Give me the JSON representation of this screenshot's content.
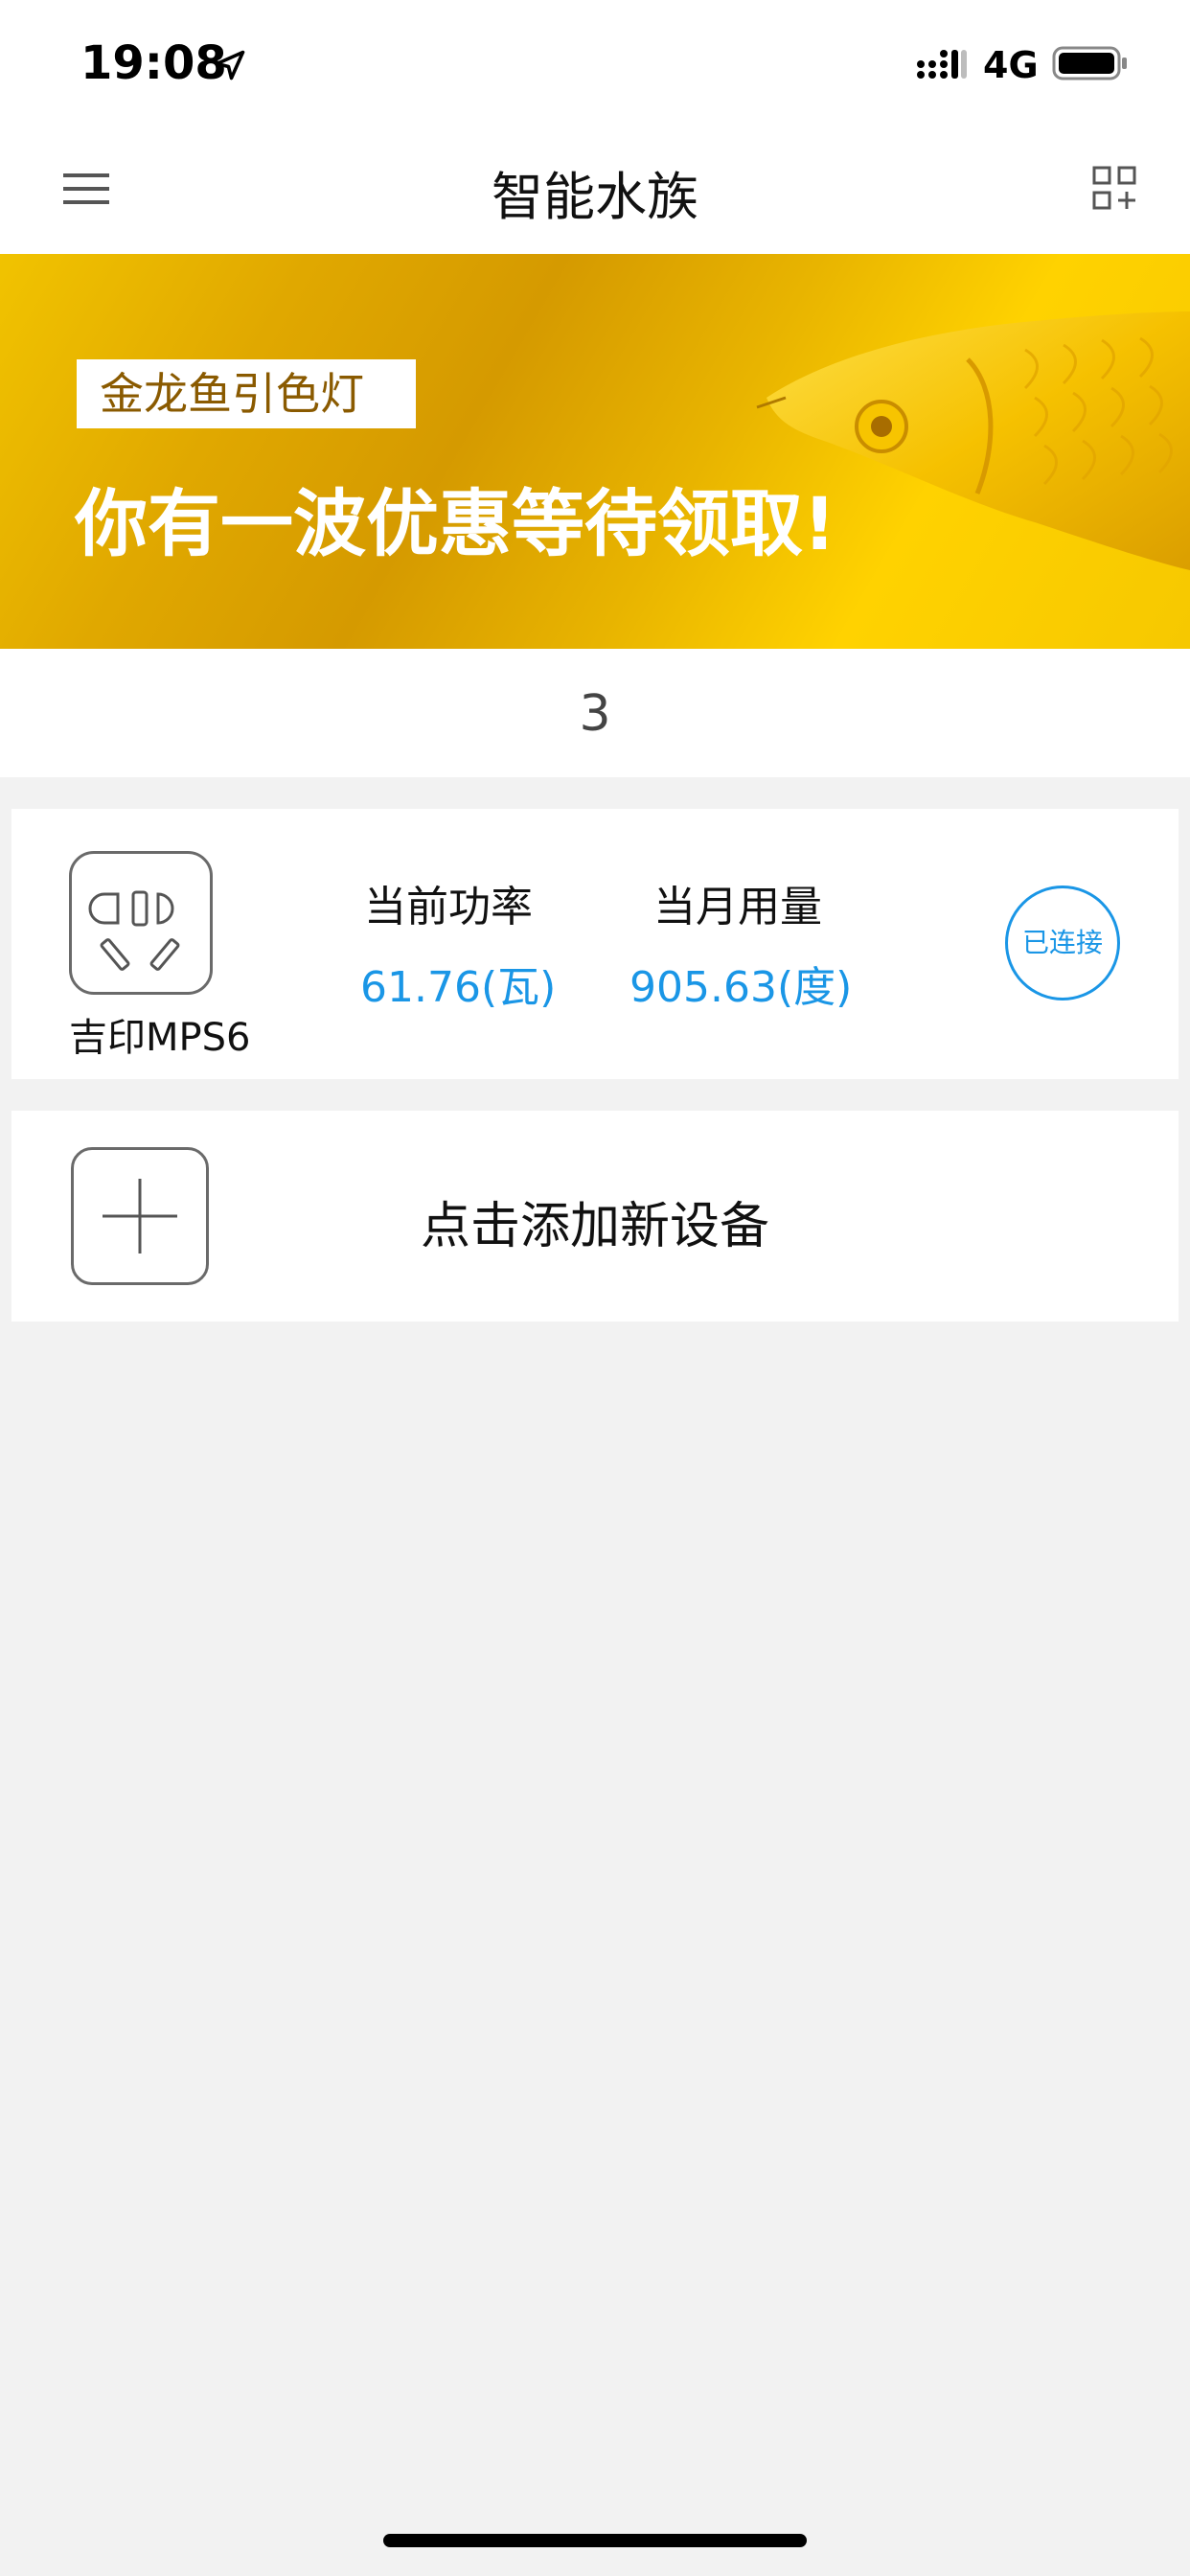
{
  "status_bar": {
    "time": "19:08",
    "network_type": "4G",
    "location_icon": "location-arrow-icon",
    "signal_icon": "cellular-signal-icon",
    "battery_icon": "battery-icon"
  },
  "nav": {
    "title": "智能水族",
    "menu_icon": "hamburger-menu-icon",
    "scan_icon": "scan-qr-add-icon"
  },
  "banner": {
    "tag": "金龙鱼引色灯",
    "headline": "你有一波优惠等待领取!",
    "image": "golden-arowana-fish"
  },
  "carousel": {
    "page_number": "3"
  },
  "device": {
    "icon": "smart-socket-icon",
    "name": "吉印MPS6",
    "power_label": "当前功率",
    "power_value": "61.76(瓦)",
    "usage_label": "当月用量",
    "usage_value": "905.63(度)",
    "status": "已连接"
  },
  "add_device": {
    "icon": "plus-icon",
    "label": "点击添加新设备"
  },
  "colors": {
    "accent": "#1a96e6",
    "banner_tag_text": "#8a5a00",
    "background": "#f2f2f2"
  }
}
